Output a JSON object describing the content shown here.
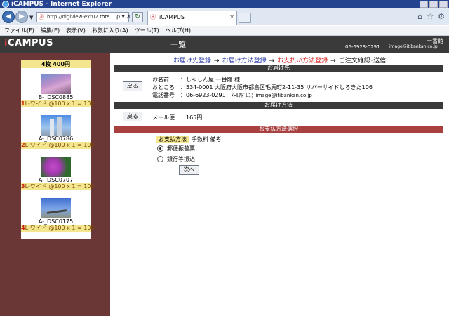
{
  "window": {
    "title": "iCAMPUS - Internet Explorer"
  },
  "browser": {
    "address_prefix": "http://digiview-ext02.",
    "address_host": "thre...",
    "tab_title": "iCAMPUS",
    "addr_tools": "ρ ▾ ✕",
    "icons": [
      "home-icon",
      "star-icon",
      "gear-icon"
    ]
  },
  "menu": [
    "ファイル(F)",
    "編集(E)",
    "表示(V)",
    "お気に入り(A)",
    "ツール(T)",
    "ヘルプ(H)"
  ],
  "header": {
    "logo_i": "i",
    "logo_rest": "CAMPUS",
    "home_link": "一覧",
    "shop_name": "一番館",
    "shop_phone": "06-6923-0291",
    "shop_email": "image@itibankan.co.jp"
  },
  "cart": {
    "summary": "4枚  400円",
    "items": [
      {
        "file": "B-_DSC0885",
        "num": "1",
        "spec": "L-ワイド",
        "calc": "@100 x 1 = 100"
      },
      {
        "file": "A-_DSC0786",
        "num": "2",
        "spec": "L-ワイド",
        "calc": "@100 x 1 = 100"
      },
      {
        "file": "A-_DSC0707",
        "num": "3",
        "spec": "L-ワイド",
        "calc": "@100 x 1 = 100"
      },
      {
        "file": "A-_DSC0175",
        "num": "4",
        "spec": "L-ワイド",
        "calc": "@100 x 1 = 100"
      }
    ]
  },
  "steps": [
    "お届け先登録",
    "お届け方法登録",
    "お支払い方法登録",
    "ご注文確認･送信"
  ],
  "delivery_address": {
    "heading": "お届け先",
    "back_label": "戻る",
    "name_label": "お名前",
    "name_value": "：しゃしん屋 一番館 様",
    "address_label": "おところ",
    "address_value": "：534-0001  大阪府大阪市都島区毛馬町2-11-35  リバーサイドしろきた106",
    "phone_label": "電話番号",
    "phone_value": "：06-6923-0291",
    "email_label": "ﾒｰﾙｱﾄﾞﾚｽ",
    "email_value": "：image@itibankan.co.jp"
  },
  "delivery_method": {
    "heading": "お届け方法",
    "back_label": "戻る",
    "method": "メール便",
    "price": "165円"
  },
  "payment": {
    "heading": "お支払方法選択",
    "column_method": "お支払方法",
    "column_rest": "手数料 備考",
    "options": [
      {
        "label": "郵便振替票",
        "selected": true
      },
      {
        "label": "銀行等振込",
        "selected": false
      }
    ],
    "next_label": "次へ"
  }
}
